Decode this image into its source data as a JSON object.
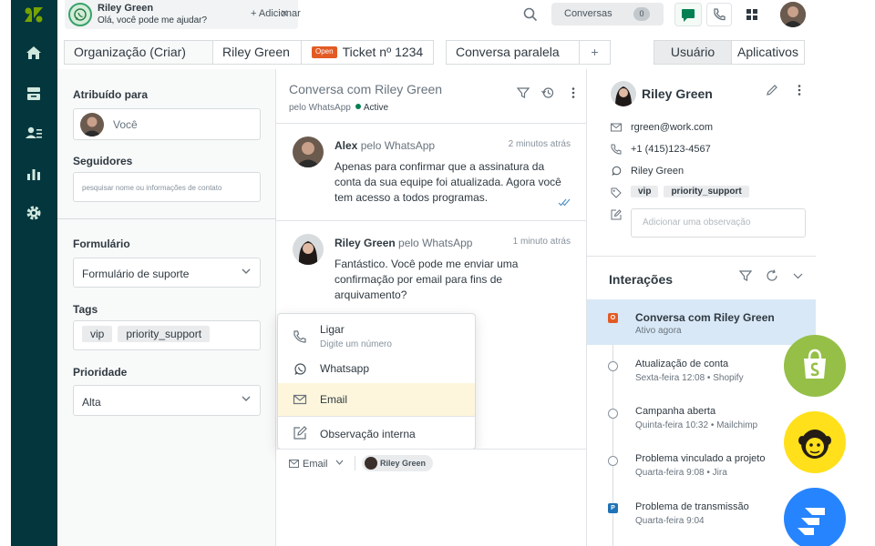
{
  "top": {
    "tab": {
      "name": "Riley Green",
      "subtitle": "Olá, você pode me ajudar?"
    },
    "add_tab_label": "+ Adicionar",
    "conversations_label": "Conversas",
    "conversations_count": "0"
  },
  "tabstrip": {
    "org": "Organização (Criar)",
    "user": "Riley Green",
    "open_badge": "Open",
    "ticket": "Ticket nº 1234",
    "side_conversation": "Conversa paralela",
    "plus": "+",
    "user_tab": "Usuário",
    "apps_tab": "Aplicativos"
  },
  "left": {
    "assigned_label": "Atribuído para",
    "assignee": "Você",
    "followers_label": "Seguidores",
    "followers_placeholder": "pesquisar nome ou informações de contato",
    "form_label": "Formulário",
    "form_value": "Formulário de suporte",
    "tags_label": "Tags",
    "tags": [
      "vip",
      "priority_support"
    ],
    "priority_label": "Prioridade",
    "priority_value": "Alta"
  },
  "conversation": {
    "title": "Conversa com Riley Green",
    "channel": "pelo WhatsApp",
    "status": "Active",
    "messages": [
      {
        "author": "Alex",
        "via": "pelo WhatsApp",
        "time": "2 minutos atrás",
        "body": "Apenas para confirmar que a assinatura da conta da sua equipe foi atualizada. Agora você tem acesso a todos programas."
      },
      {
        "author": "Riley Green",
        "via": "pelo WhatsApp",
        "time": "1 minuto atrás",
        "body": "Fantástico. Você pode me enviar uma confirmação por email para fins de arquivamento?"
      }
    ]
  },
  "channel_menu": {
    "items": [
      {
        "label": "Ligar",
        "sub": "Digite um número"
      },
      {
        "label": "Whatsapp",
        "sub": ""
      },
      {
        "label": "Email",
        "sub": ""
      },
      {
        "label": "Observação interna",
        "sub": ""
      }
    ]
  },
  "composer": {
    "channel": "Email",
    "recipient": "Riley Green"
  },
  "contact": {
    "name": "Riley Green",
    "email": "rgreen@work.com",
    "phone": "+1 (415)123-4567",
    "whatsapp": "Riley Green",
    "tags": [
      "vip",
      "priority_support"
    ],
    "note_placeholder": "Adicionar uma observação"
  },
  "interactions": {
    "title": "Interações",
    "items": [
      {
        "title": "Conversa com Riley Green",
        "sub": "Ativo agora",
        "marker": "square",
        "marker_text": "O",
        "marker_color": "#e35b24"
      },
      {
        "title": "Atualização de conta",
        "sub": "Sexta-feira 12:08 • Shopify",
        "marker": "circle"
      },
      {
        "title": "Campanha aberta",
        "sub": "Quinta-feira 10:32 • Mailchimp",
        "marker": "circle"
      },
      {
        "title": "Problema vinculado a projeto",
        "sub": "Quarta-feira 9:08 • Jira",
        "marker": "circle"
      },
      {
        "title": "Problema de transmissão",
        "sub": "Quarta-feira 9:04",
        "marker": "square",
        "marker_text": "P",
        "marker_color": "#1f73b7"
      }
    ]
  },
  "colors": {
    "sidebar": "#03363d",
    "open_badge": "#e35b24",
    "active_interaction": "#d9e8f6",
    "menu_highlight": "#fdf6dc",
    "shopify": "#95bf47",
    "mailchimp": "#ffe01b",
    "jira": "#2684ff"
  },
  "icons": [
    "zendesk-logo-icon",
    "home-icon",
    "inbox-icon",
    "contacts-icon",
    "reports-icon",
    "settings-icon",
    "whatsapp-icon",
    "search-icon",
    "chat-icon",
    "phone-icon",
    "grid-icon",
    "filter-icon",
    "history-icon",
    "more-icon",
    "email-icon",
    "note-icon",
    "edit-icon",
    "tag-icon",
    "refresh-icon",
    "chevron-down-icon",
    "shopify-icon",
    "mailchimp-icon",
    "jira-icon"
  ]
}
